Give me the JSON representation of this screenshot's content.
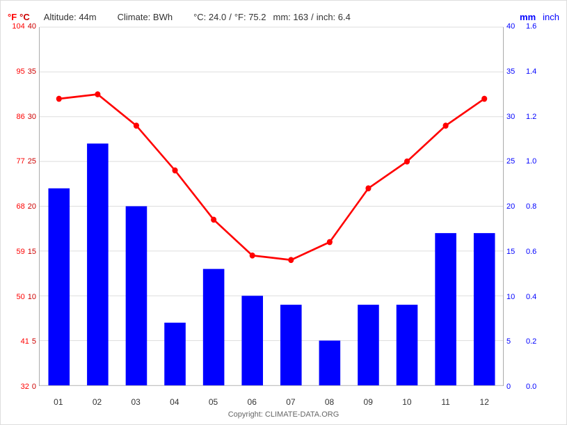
{
  "header": {
    "f_label": "°F",
    "c_label": "°C",
    "altitude": "Altitude: 44m",
    "climate": "Climate: BWh",
    "temp_c": "°C: 24.0",
    "temp_f": "°F: 75.2",
    "mm": "mm: 163",
    "inch": "inch: 6.4",
    "mm_axis": "mm",
    "inch_axis": "inch"
  },
  "months": [
    "01",
    "02",
    "03",
    "04",
    "05",
    "06",
    "07",
    "08",
    "09",
    "10",
    "11",
    "12"
  ],
  "precipitation_mm": [
    22,
    27,
    20,
    7,
    13,
    10,
    9,
    5,
    9,
    9,
    17,
    17
  ],
  "temperature_c": [
    32,
    32.5,
    29,
    24,
    18.5,
    14.5,
    14,
    16,
    22,
    25,
    29,
    32
  ],
  "left_axis": {
    "f_values": [
      104,
      95,
      86,
      77,
      68,
      59,
      50,
      41,
      32
    ],
    "c_values": [
      40,
      35,
      30,
      25,
      20,
      15,
      10,
      5,
      0
    ]
  },
  "right_axis": {
    "mm_values": [
      40,
      35,
      30,
      25,
      20,
      15,
      10,
      5,
      0
    ],
    "inch_values": [
      "1.4",
      "1.2",
      "1.0",
      "0.8",
      "0.6",
      "0.4",
      "0.2",
      "0.0"
    ]
  },
  "copyright": "Copyright: CLIMATE-DATA.ORG",
  "colors": {
    "bar": "blue",
    "temp_line": "red",
    "axis_f": "red",
    "axis_c": "#cc0000",
    "axis_right": "blue"
  }
}
